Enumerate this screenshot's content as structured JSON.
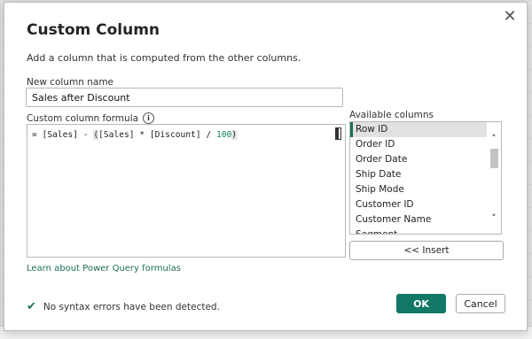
{
  "dialog": {
    "title": "Custom Column",
    "description": "Add a column that is computed from the other columns.",
    "close_glyph": "✕"
  },
  "new_column": {
    "label": "New column name",
    "value": "Sales after Discount"
  },
  "formula": {
    "label": "Custom column formula",
    "info_glyph": "i",
    "text_prefix": "= [Sales] - ",
    "text_paren_open": "(",
    "text_middle": "[Sales] * [Discount] / ",
    "text_number": "100",
    "text_paren_close": ")"
  },
  "available": {
    "label": "Available columns",
    "items": [
      "Row ID",
      "Order ID",
      "Order Date",
      "Ship Date",
      "Ship Mode",
      "Customer ID",
      "Customer Name",
      "Segment"
    ],
    "selected_index": 0,
    "insert_label": "<< Insert"
  },
  "learn_link": "Learn about Power Query formulas",
  "status": {
    "text": "No syntax errors have been detected.",
    "icon": "check-icon"
  },
  "buttons": {
    "ok": "OK",
    "cancel": "Cancel"
  },
  "colors": {
    "accent": "#117865",
    "link": "#1d6d5a",
    "number": "#098658"
  }
}
